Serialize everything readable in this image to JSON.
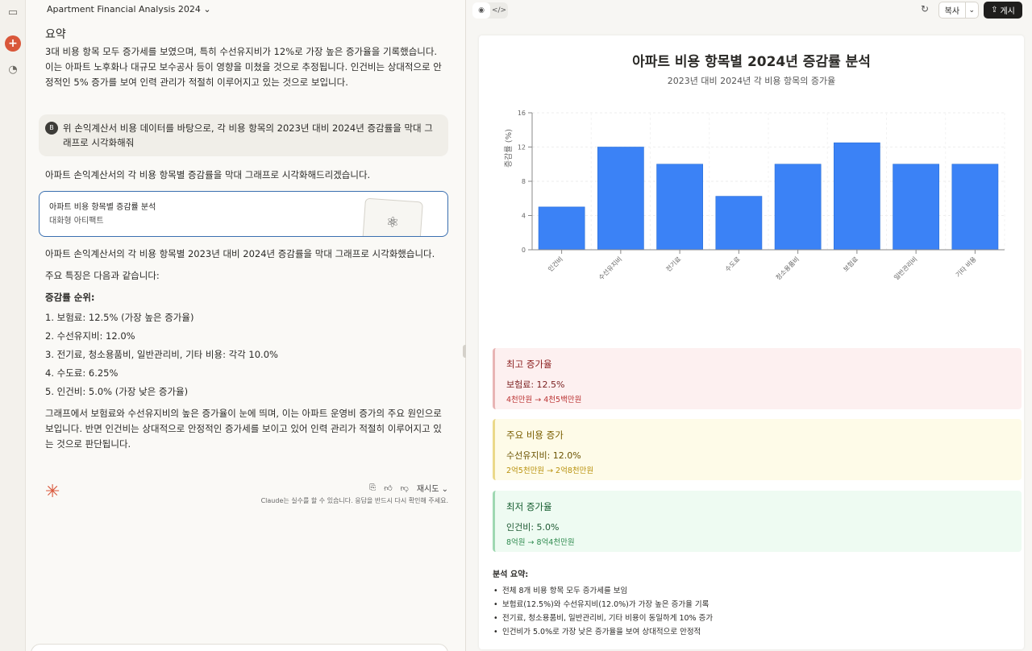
{
  "icons": {
    "sidebar_toggle": "sidebar-icon",
    "new_chat": "plus-icon",
    "recent": "history-icon"
  },
  "chat": {
    "title": "Apartment Financial Analysis 2024",
    "summary_heading": "요약",
    "summary_text": "3대 비용 항목 모두 증가세를 보였으며, 특히 수선유지비가 12%로 가장 높은 증가율을 기록했습니다. 이는 아파트 노후화나 대규모 보수공사 등이 영향을 미쳤을 것으로 추정됩니다. 인건비는 상대적으로 안정적인 5% 증가를 보여 인력 관리가 적절히 이루어지고 있는 것으로 보입니다.",
    "user_avatar": "B",
    "user_message": "위 손익계산서 비용 데이터를 바탕으로, 각 비용 항목의 2023년 대비 2024년 증감률을 막대 그래프로 시각화해줘",
    "reply_intro": "아파트 손익계산서의 각 비용 항목별 증감률을 막대 그래프로 시각화해드리겠습니다.",
    "artifact": {
      "title": "아파트 비용 항목별 증감률 분석",
      "subtitle": "대화형 아티팩트"
    },
    "reply_result": "아파트 손익계산서의 각 비용 항목별 2023년 대비 2024년 증감률을 막대 그래프로 시각화했습니다.",
    "features_intro": "주요 특징은 다음과 같습니다:",
    "ranking_heading": "증감률 순위:",
    "ranking": [
      "1. 보험료: 12.5% (가장 높은 증가율)",
      "2. 수선유지비: 12.0%",
      "3. 전기료, 청소용품비, 일반관리비, 기타 비용: 각각 10.0%",
      "4. 수도료: 6.25%",
      "5. 인건비: 5.0% (가장 낮은 증가율)"
    ],
    "conclusion": "그래프에서 보험료와 수선유지비의 높은 증가율이 눈에 띄며, 이는 아파트 운영비 증가의 주요 원인으로 보입니다. 반면 인건비는 상대적으로 안정적인 증가세를 보이고 있어 인력 관리가 적절히 이루어지고 있는 것으로 판단됩니다.",
    "retry_label": "재시도",
    "disclaimer": "Claude는 실수를 할 수 있습니다. 응답을 반드시 다시 확인해 주세요."
  },
  "toolbar": {
    "copy_label": "복사",
    "publish_label": "게시"
  },
  "doc": {
    "title": "아파트 비용 항목별 2024년 증감률 분석",
    "subtitle": "2023년 대비 2024년 각 비용 항목의 증가율",
    "ylabel": "증감률 (%)",
    "cards": {
      "highest": {
        "title": "최고 증가율",
        "main": "보험료: 12.5%",
        "detail": "4천만원 → 4천5백만원"
      },
      "major": {
        "title": "주요 비용 증가",
        "main": "수선유지비: 12.0%",
        "detail": "2억5천만원 → 2억8천만원"
      },
      "lowest": {
        "title": "최저 증가율",
        "main": "인건비: 5.0%",
        "detail": "8억원 → 8억4천만원"
      }
    },
    "analysis_title": "분석 요약:",
    "analysis_items": [
      "전체 8개 비용 항목 모두 증가세를 보임",
      "보험료(12.5%)와 수선유지비(12.0%)가 가장 높은 증가율 기록",
      "전기료, 청소용품비, 일반관리비, 기타 비용이 동일하게 10% 증가",
      "인건비가 5.0%로 가장 낮은 증가율을 보여 상대적으로 안정적"
    ]
  },
  "chart_data": {
    "type": "bar",
    "categories": [
      "인건비",
      "수선유지비",
      "전기료",
      "수도료",
      "청소용품비",
      "보험료",
      "일반관리비",
      "기타 비용"
    ],
    "values": [
      5.0,
      12.0,
      10.0,
      6.25,
      10.0,
      12.5,
      10.0,
      10.0
    ],
    "ylabel": "증감률 (%)",
    "ylim": [
      0,
      16
    ],
    "yticks": [
      0,
      4,
      8,
      12,
      16
    ],
    "grid": true,
    "bar_color": "#3b82f6"
  }
}
